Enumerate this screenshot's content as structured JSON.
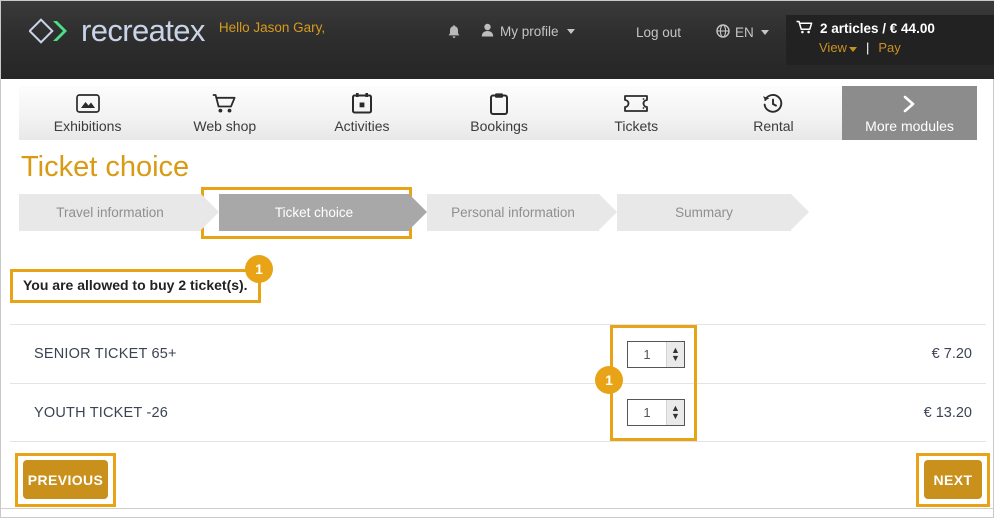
{
  "header": {
    "logo_text": "recreatex",
    "logo_icon": "diamond-chevron-logo-icon",
    "greeting": "Hello Jason Gary,",
    "bell_icon": "notification-bell-icon",
    "profile_icon": "user-icon",
    "profile_label": "My profile",
    "logout_label": "Log out",
    "language_icon": "globe-icon",
    "language_label": "EN",
    "cart": {
      "cart_icon": "shopping-cart-icon",
      "summary": "2 articles / € 44.00",
      "view_label": "View",
      "separator": "|",
      "pay_label": "Pay"
    }
  },
  "nav": {
    "items": [
      {
        "label": "Exhibitions",
        "icon": "picture-frame-icon",
        "active": false
      },
      {
        "label": "Web shop",
        "icon": "shopping-cart-icon",
        "active": false
      },
      {
        "label": "Activities",
        "icon": "calendar-icon",
        "active": false
      },
      {
        "label": "Bookings",
        "icon": "clipboard-icon",
        "active": false
      },
      {
        "label": "Tickets",
        "icon": "ticket-icon",
        "active": false
      },
      {
        "label": "Rental",
        "icon": "clock-history-icon",
        "active": false
      }
    ],
    "more": {
      "label": "More modules",
      "icon": "chevron-right-icon"
    }
  },
  "main": {
    "page_title": "Ticket choice",
    "steps": [
      {
        "label": "Travel information",
        "state": "done"
      },
      {
        "label": "Ticket choice",
        "state": "active"
      },
      {
        "label": "Personal information",
        "state": "upcoming"
      },
      {
        "label": "Summary",
        "state": "upcoming"
      }
    ],
    "alert": "You are allowed to buy 2 ticket(s).",
    "annotations": [
      {
        "number": "1",
        "target": "alert-message"
      },
      {
        "number": "1",
        "target": "quantity-steppers"
      }
    ],
    "tickets": [
      {
        "name": "SENIOR TICKET 65+",
        "quantity": "1",
        "price": "€ 7.20"
      },
      {
        "name": "YOUTH TICKET -26",
        "quantity": "1",
        "price": "€ 13.20"
      }
    ],
    "buttons": {
      "previous": "PREVIOUS",
      "next": "NEXT"
    }
  },
  "colors": {
    "accent_orange": "#e8a317",
    "title_orange": "#d99a14",
    "button_gold": "#c9911b",
    "header_dark": "#2e2e2e",
    "step_active_gray": "#a8a8a8"
  }
}
